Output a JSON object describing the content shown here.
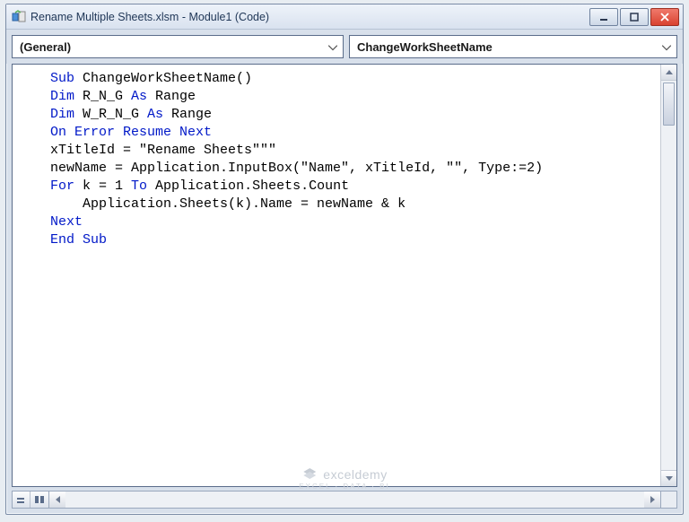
{
  "window": {
    "title": "Rename Multiple Sheets.xlsm - Module1 (Code)"
  },
  "dropdowns": {
    "object": "(General)",
    "procedure": "ChangeWorkSheetName"
  },
  "code": {
    "lines": [
      {
        "tokens": [
          [
            "kw",
            "Sub"
          ],
          [
            "",
            " ChangeWorkSheetName()"
          ]
        ]
      },
      {
        "tokens": [
          [
            "kw",
            "Dim"
          ],
          [
            "",
            " R_N_G "
          ],
          [
            "kw",
            "As"
          ],
          [
            "",
            " Range"
          ]
        ]
      },
      {
        "tokens": [
          [
            "kw",
            "Dim"
          ],
          [
            "",
            " W_R_N_G "
          ],
          [
            "kw",
            "As"
          ],
          [
            "",
            " Range"
          ]
        ]
      },
      {
        "tokens": [
          [
            "kw",
            "On Error Resume Next"
          ]
        ]
      },
      {
        "tokens": [
          [
            "",
            "xTitleId = \"Rename Sheets\"\"\""
          ]
        ]
      },
      {
        "tokens": [
          [
            "",
            "newName = Application.InputBox(\"Name\", xTitleId, \"\", Type:=2)"
          ]
        ]
      },
      {
        "tokens": [
          [
            "kw",
            "For"
          ],
          [
            "",
            " k = 1 "
          ],
          [
            "kw",
            "To"
          ],
          [
            "",
            " Application.Sheets.Count"
          ]
        ]
      },
      {
        "tokens": [
          [
            "",
            "    Application.Sheets(k).Name = newName & k"
          ]
        ]
      },
      {
        "tokens": [
          [
            "kw",
            "Next"
          ]
        ]
      },
      {
        "tokens": [
          [
            "kw",
            "End Sub"
          ]
        ]
      }
    ]
  },
  "watermark": {
    "brand": "exceldemy",
    "tagline": "EXCEL · DATA · BI"
  }
}
